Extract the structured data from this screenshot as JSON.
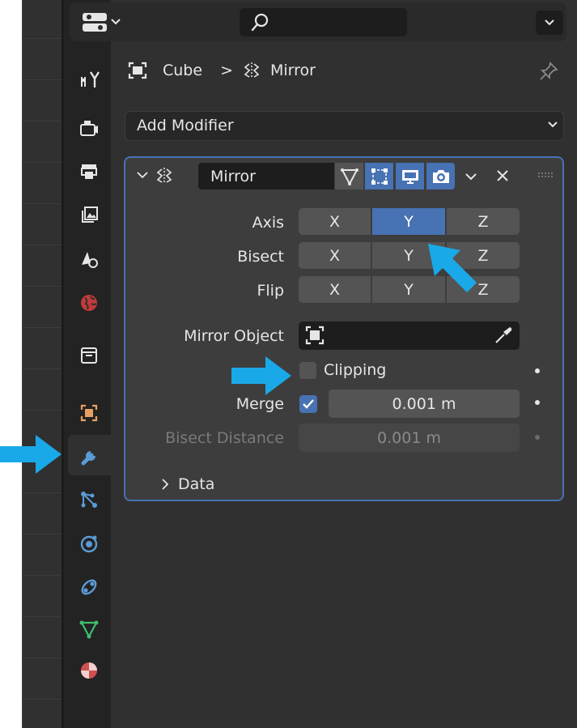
{
  "header": {
    "search_placeholder": ""
  },
  "breadcrumb": {
    "object": "Cube",
    "modifier": "Mirror",
    "separator": ">"
  },
  "add_modifier": {
    "label": "Add Modifier"
  },
  "modifier": {
    "name": "Mirror",
    "axis": {
      "label": "Axis",
      "options": [
        "X",
        "Y",
        "Z"
      ],
      "active": "Y"
    },
    "bisect": {
      "label": "Bisect",
      "options": [
        "X",
        "Y",
        "Z"
      ]
    },
    "flip": {
      "label": "Flip",
      "options": [
        "X",
        "Y",
        "Z"
      ]
    },
    "mirror_object": {
      "label": "Mirror Object",
      "value": ""
    },
    "clipping": {
      "label": "Clipping",
      "checked": false
    },
    "merge": {
      "label": "Merge",
      "checked": true,
      "value": "0.001 m"
    },
    "bisect_distance": {
      "label": "Bisect Distance",
      "value": "0.001 m",
      "disabled": true
    },
    "data_section": {
      "label": "Data",
      "expanded": false
    }
  },
  "tabs": [
    "tool",
    "render",
    "output",
    "view-layer",
    "scene",
    "world",
    "collection",
    "object",
    "modifiers",
    "particles",
    "physics",
    "constraints",
    "data",
    "material"
  ],
  "active_tab": "modifiers",
  "colors": {
    "accent": "#4772b3",
    "annotation_arrow": "#1aa9e8",
    "panel_bg": "#303030",
    "subpanel_bg": "#3d3d3d"
  }
}
